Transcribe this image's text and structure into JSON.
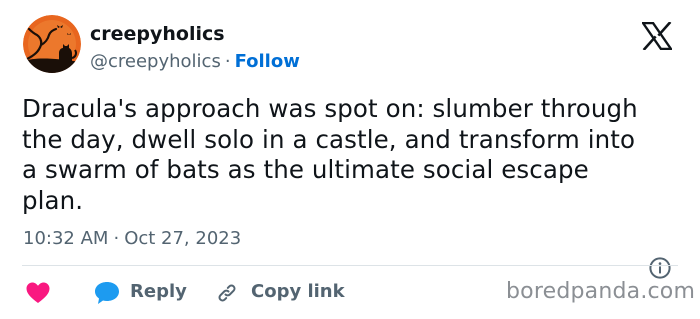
{
  "author": {
    "display_name": "creepyholics",
    "handle": "@creepyholics",
    "follow_label": "Follow"
  },
  "tweet": {
    "text": "Dracula's approach was spot on: slumber through\nthe day, dwell solo in a castle, and transform into\na swarm of bats as the ultimate social escape\nplan.",
    "time": "10:32 AM",
    "date": "Oct 27, 2023"
  },
  "actions": {
    "reply_label": "Reply",
    "copy_link_label": "Copy link"
  },
  "watermark": "boredpanda.com",
  "icons": {
    "avatar": "halloween-moon-avatar",
    "platform": "x-logo-icon",
    "info": "info-icon",
    "like": "heart-icon",
    "reply": "speech-bubble-icon",
    "copy": "link-icon"
  },
  "colors": {
    "text": "#0f1419",
    "muted": "#536471",
    "link": "#006fd6",
    "heart": "#f91880",
    "reply": "#1d9bf0",
    "divider": "#dde3e7",
    "watermark": "#8b8f94",
    "avatar_orange": "#e8661f"
  }
}
